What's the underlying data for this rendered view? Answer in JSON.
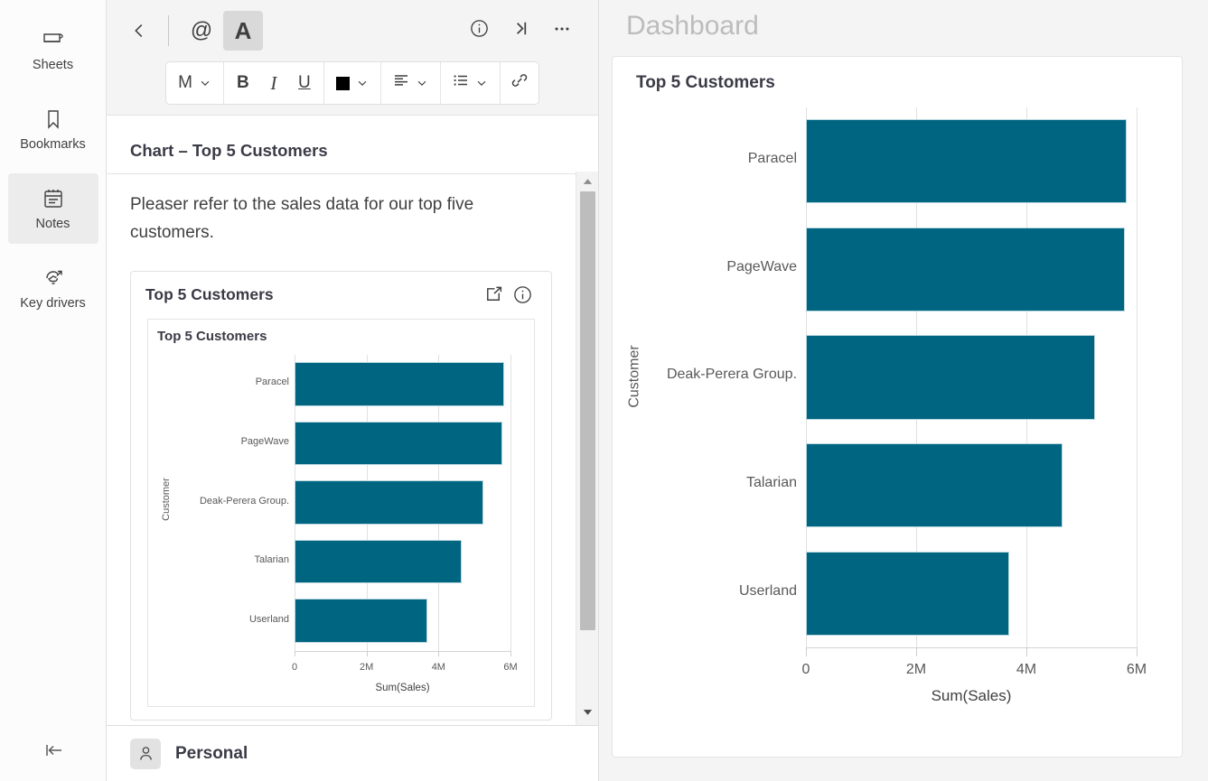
{
  "rail": {
    "items": [
      {
        "label": "Sheets",
        "icon": "sheets-icon",
        "active": false
      },
      {
        "label": "Bookmarks",
        "icon": "bookmark-icon",
        "active": false
      },
      {
        "label": "Notes",
        "icon": "notes-icon",
        "active": true
      },
      {
        "label": "Key drivers",
        "icon": "key-drivers-icon",
        "active": false
      }
    ],
    "collapse_icon": "collapse-left-icon",
    "accent_color": "#008a3f",
    "active_background": "#ececec"
  },
  "notes": {
    "toolbar": {
      "back_label": "‹",
      "mention_label": "@",
      "text_format_label": "A",
      "info_icon": "info-icon",
      "collapse_icon": "collapse-right-icon",
      "more_icon": "more-options-icon",
      "format": {
        "size_label": "M",
        "bold_label": "B",
        "italic_label": "I",
        "underline_label": "U",
        "color_swatch": "#000000",
        "align_icon": "align-left-icon",
        "list_icon": "bulleted-list-icon",
        "link_icon": "link-icon"
      }
    },
    "title": "Chart – Top 5 Customers",
    "body_text": "Pleaser refer to the sales data for our top five customers.",
    "embed": {
      "title": "Top 5 Customers",
      "export_icon": "export-icon",
      "info_icon": "info-icon"
    },
    "footer": {
      "avatar_icon": "person-icon",
      "name": "Personal"
    }
  },
  "dashboard": {
    "title": "Dashboard",
    "card_title": "Top 5 Customers"
  },
  "chart_data": {
    "type": "bar",
    "orientation": "horizontal",
    "title": "Top 5 Customers",
    "categories": [
      "Paracel",
      "PageWave",
      "Deak-Perera Group.",
      "Talarian",
      "Userland"
    ],
    "values": [
      5820000,
      5780000,
      5240000,
      4650000,
      3690000
    ],
    "xlabel": "Sum(Sales)",
    "ylabel": "Customer",
    "xlim": [
      0,
      6000000
    ],
    "xticks": [
      0,
      2000000,
      4000000,
      6000000
    ],
    "xtick_labels": [
      "0",
      "2M",
      "4M",
      "6M"
    ],
    "bar_color": "#006580",
    "grid": true,
    "legend": false
  }
}
